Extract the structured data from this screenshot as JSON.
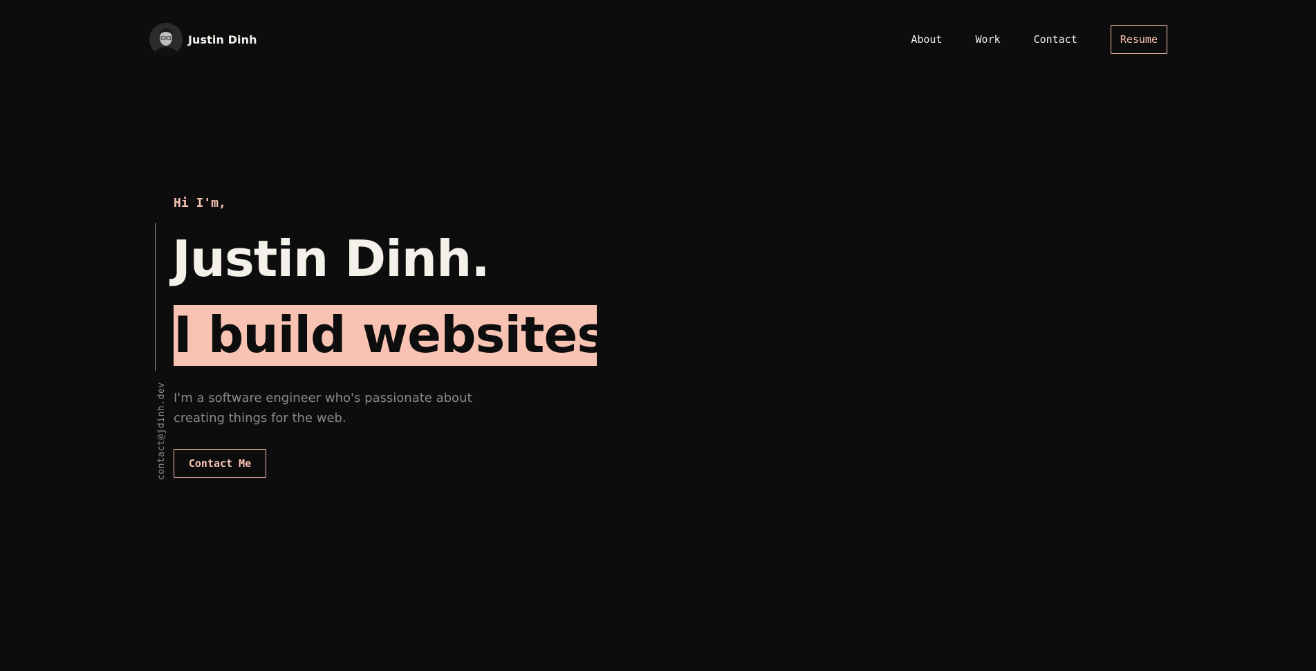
{
  "header": {
    "brand_name": "Justin Dinh",
    "avatar_icon": "person-photo-icon",
    "nav": [
      {
        "label": "About"
      },
      {
        "label": "Work"
      },
      {
        "label": "Contact"
      }
    ],
    "resume_label": "Resume"
  },
  "hero": {
    "greeting": "Hi I'm,",
    "name": "Justin Dinh.",
    "tagline": "I build websites.",
    "intro": "I'm a software engineer who's passionate about creating things for the web.",
    "cta_label": "Contact Me"
  },
  "sidebar": {
    "email": "contact@jdinh.dev"
  },
  "colors": {
    "background": "#0d0d0d",
    "accent": "#f8c3b3",
    "text": "#f4f1ea",
    "muted": "#8d8a84"
  }
}
